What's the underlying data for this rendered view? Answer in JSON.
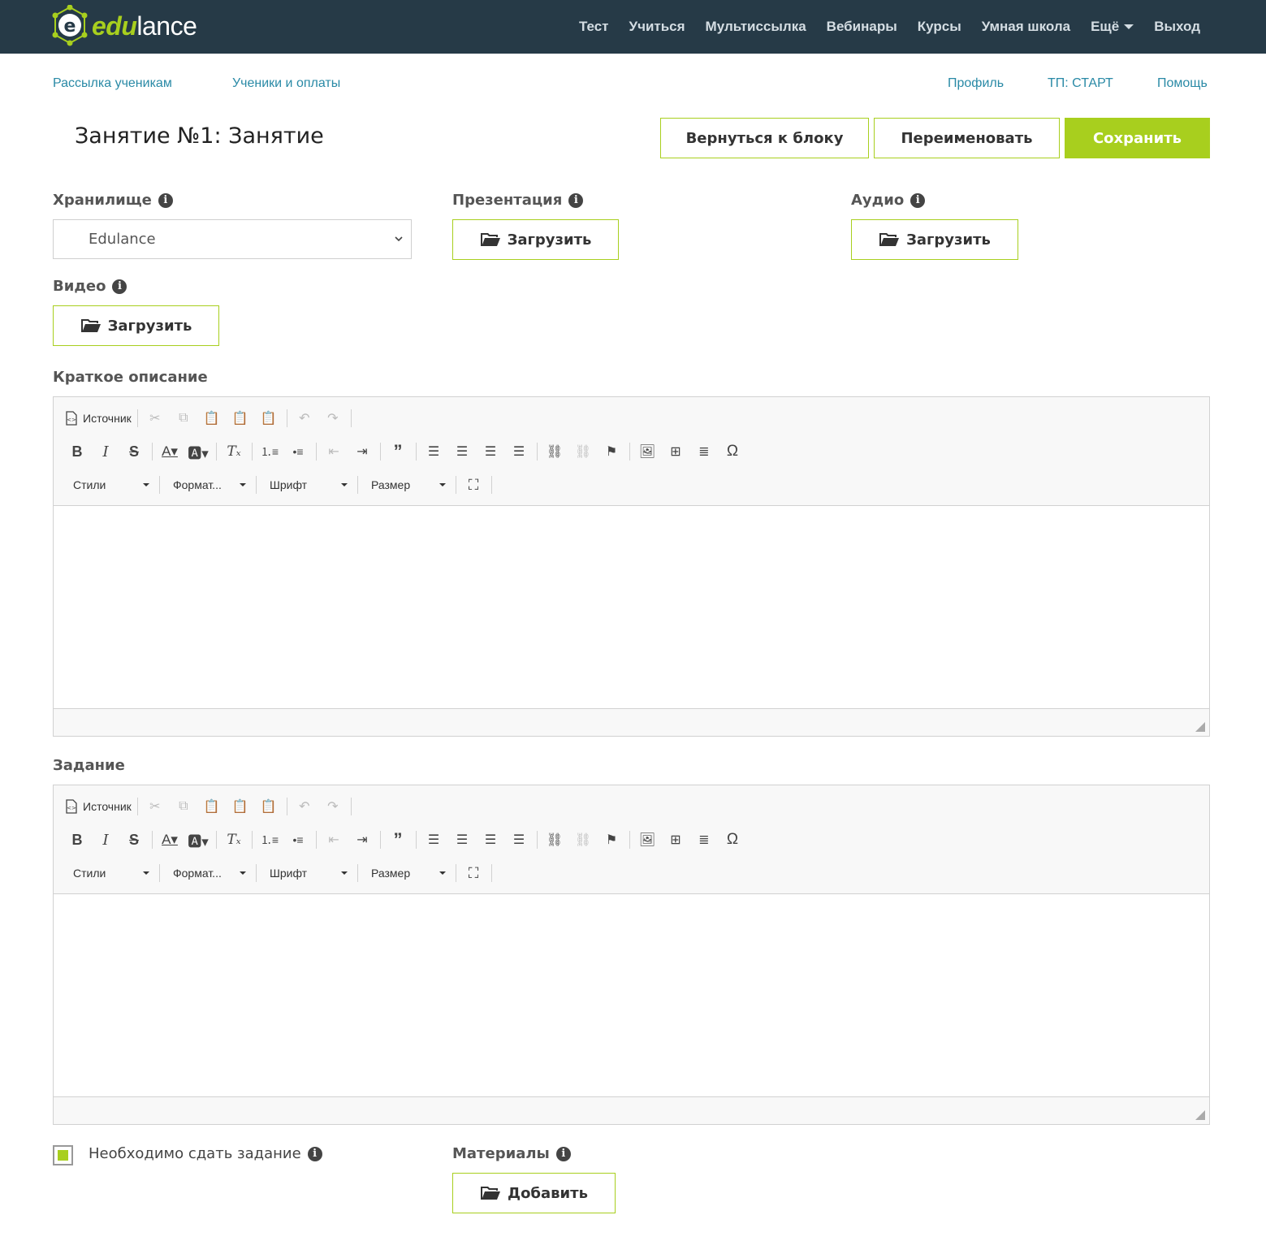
{
  "brand": {
    "edu": "edu",
    "lance": "lance"
  },
  "nav": {
    "items": [
      "Тест",
      "Учиться",
      "Мультиссылка",
      "Вебинары",
      "Курсы",
      "Умная школа",
      "Ещё",
      "Выход"
    ]
  },
  "sublinks": {
    "mailing": "Рассылка ученикам",
    "students": "Ученики и оплаты",
    "profile": "Профиль",
    "plan": "ТП: СТАРТ",
    "help": "Помощь"
  },
  "page": {
    "title": "Занятие №1: Занятие",
    "back_label": "Вернуться к блоку",
    "rename_label": "Переименовать",
    "save_label": "Сохранить"
  },
  "fields": {
    "storage_label": "Хранилище",
    "storage_value": "Edulance",
    "presentation_label": "Презентация",
    "audio_label": "Аудио",
    "video_label": "Видео",
    "upload_label": "Загрузить",
    "short_desc_label": "Краткое описание",
    "task_label": "Задание",
    "require_task_label": "Необходимо сдать задание",
    "materials_label": "Материалы",
    "add_label": "Добавить",
    "info_glyph": "i"
  },
  "editor": {
    "source_label": "Источник",
    "styles_label": "Стили",
    "format_label": "Формат...",
    "font_label": "Шрифт",
    "size_label": "Размер"
  },
  "colors": {
    "accent": "#a8cf1e",
    "topbar": "#263a47",
    "link": "#2a8aa6"
  }
}
